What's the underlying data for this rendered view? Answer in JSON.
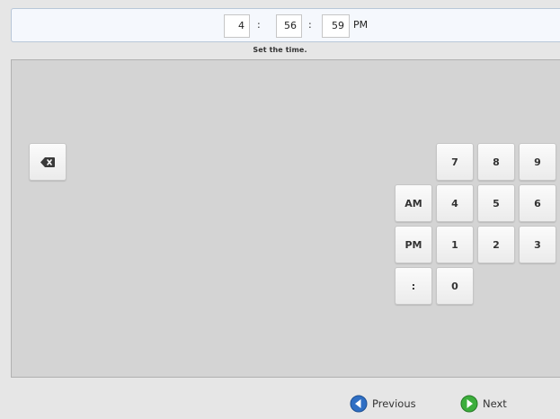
{
  "time": {
    "hours": "4",
    "separator": ":",
    "minutes": "56",
    "seconds": "59",
    "meridiem": "PM"
  },
  "prompt": "Set the time.",
  "keypad": {
    "backspace_icon": "backspace-icon",
    "digits": [
      "7",
      "8",
      "9",
      "4",
      "5",
      "6",
      "1",
      "2",
      "3",
      "0"
    ],
    "am": "AM",
    "pm": "PM",
    "colon": ":"
  },
  "nav": {
    "previous": "Previous",
    "next": "Next"
  },
  "colors": {
    "previous_icon": "#2f6fc4",
    "next_icon": "#3cae3c"
  }
}
